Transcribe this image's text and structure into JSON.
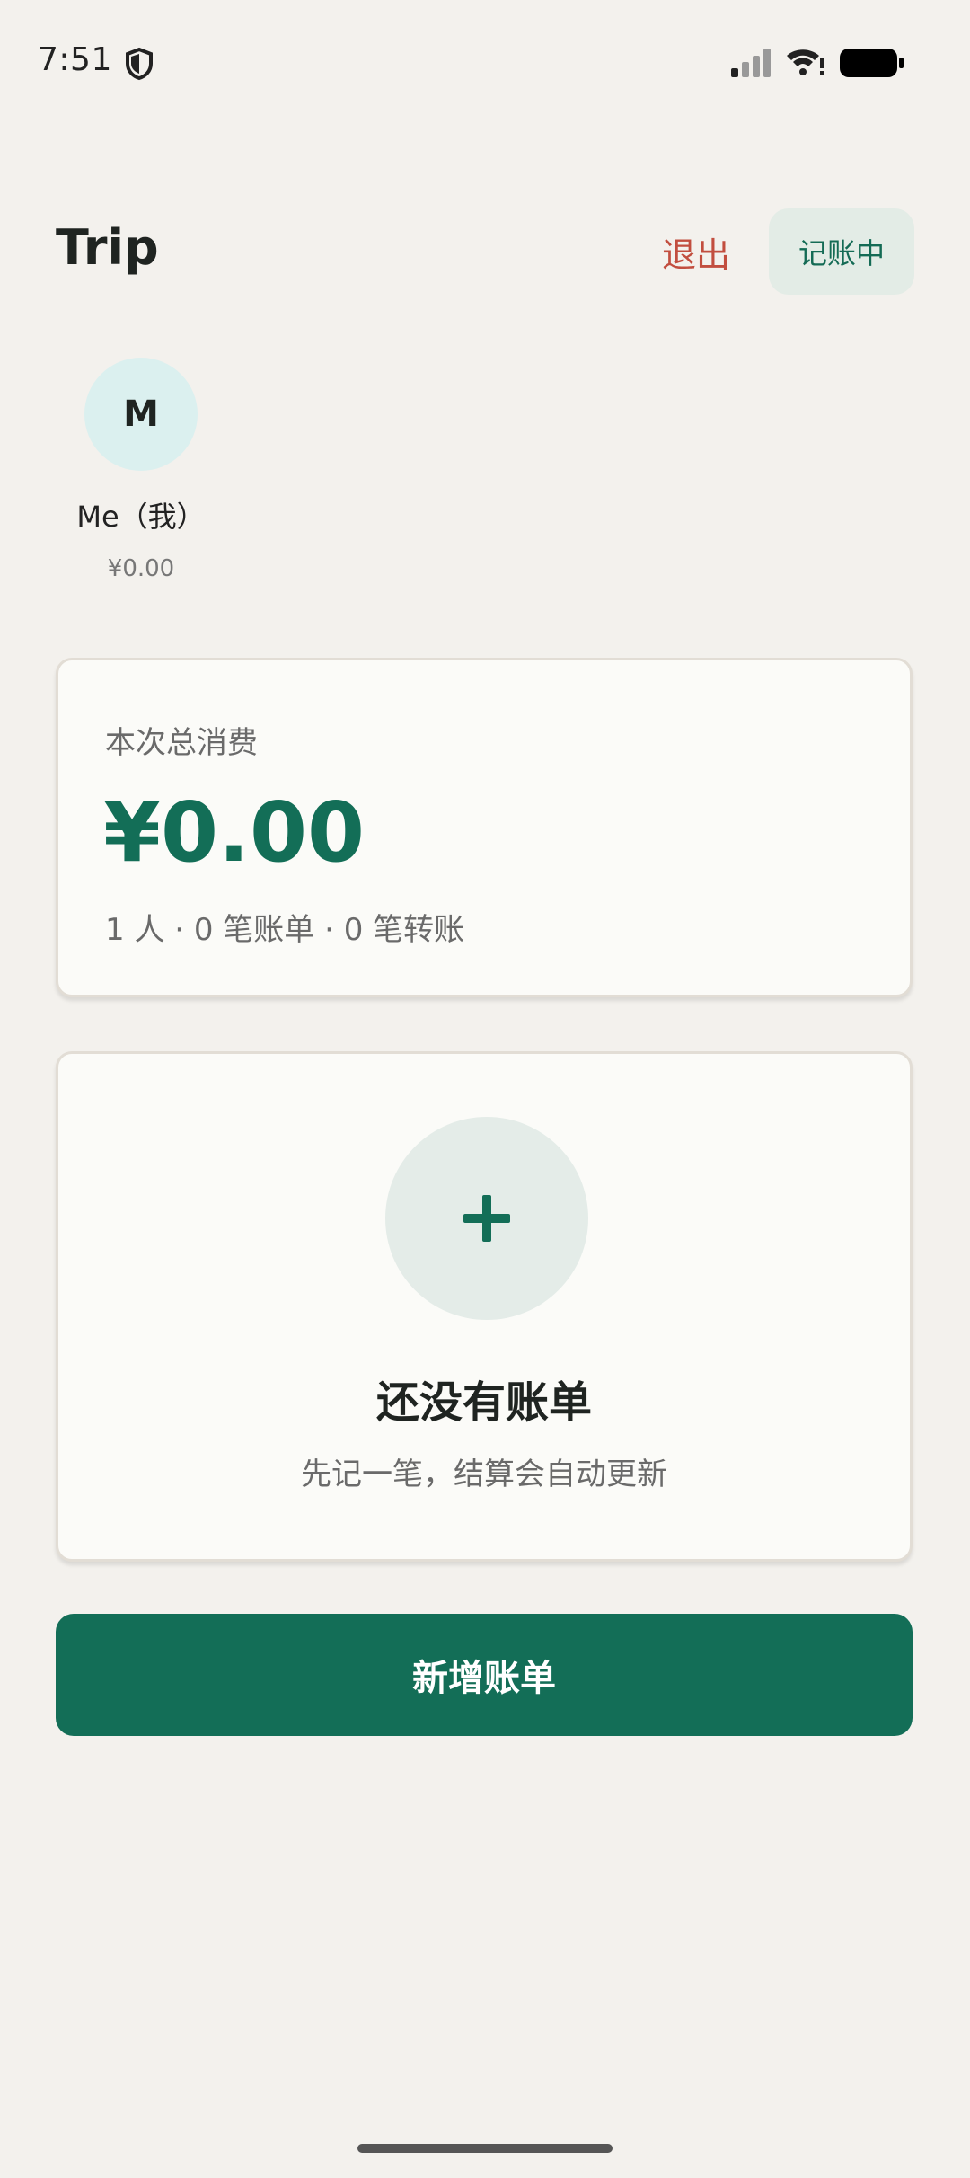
{
  "status_bar": {
    "time": "7:51",
    "icons": [
      "shield-icon",
      "signal-icon",
      "wifi-icon",
      "battery-icon"
    ]
  },
  "header": {
    "title": "Trip",
    "exit_label": "退出",
    "status_label": "记账中"
  },
  "members": [
    {
      "initial": "M",
      "name": "Me（我）",
      "amount": "¥0.00"
    }
  ],
  "summary": {
    "label": "本次总消费",
    "total": "¥0.00",
    "meta": "1 人 · 0 笔账单 · 0 笔转账"
  },
  "empty_state": {
    "icon": "plus-icon",
    "title": "还没有账单",
    "subtitle": "先记一笔，结算会自动更新"
  },
  "actions": {
    "add_bill_label": "新增账单"
  },
  "colors": {
    "background": "#f3f1ed",
    "accent": "#136e57",
    "danger": "#c24e3f",
    "avatar_bg": "#dbf0ef",
    "pill_bg": "#e3ece6"
  }
}
